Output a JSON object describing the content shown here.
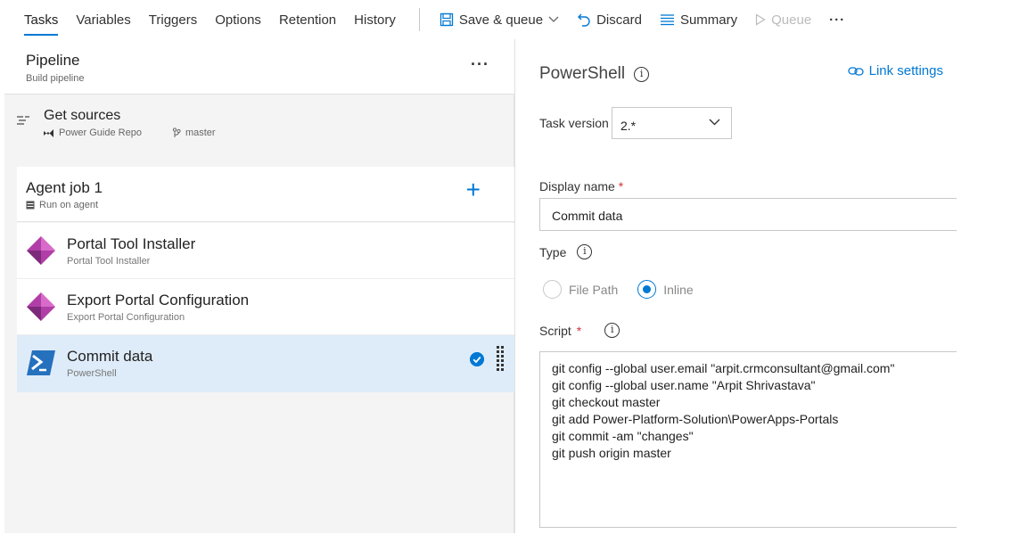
{
  "toolbar": {
    "tabs": [
      "Tasks",
      "Variables",
      "Triggers",
      "Options",
      "Retention",
      "History"
    ],
    "active_tab": "Tasks",
    "save_queue": "Save & queue",
    "discard": "Discard",
    "summary": "Summary",
    "queue": "Queue",
    "more": "···"
  },
  "pipeline": {
    "title": "Pipeline",
    "subtitle": "Build pipeline",
    "more": "···"
  },
  "get_sources": {
    "title": "Get sources",
    "repo": "Power Guide Repo",
    "branch": "master"
  },
  "agent_job": {
    "title": "Agent job 1",
    "subtitle": "Run on agent",
    "add": "+"
  },
  "tasks": [
    {
      "title": "Portal Tool Installer",
      "subtitle": "Portal Tool Installer",
      "icon": "power-apps-icon"
    },
    {
      "title": "Export Portal Configuration",
      "subtitle": "Export Portal Configuration",
      "icon": "power-apps-icon"
    },
    {
      "title": "Commit data",
      "subtitle": "PowerShell",
      "icon": "powershell-icon",
      "selected": true
    }
  ],
  "detail": {
    "title": "PowerShell",
    "link_settings": "Link settings",
    "task_version_label": "Task version",
    "task_version_value": "2.*",
    "display_name_label": "Display name",
    "required_mark": "*",
    "display_name_value": "Commit data",
    "type_label": "Type",
    "type_options": [
      "File Path",
      "Inline"
    ],
    "type_selected": "Inline",
    "script_label": "Script",
    "script_lines": [
      "git config --global user.email \"arpit.crmconsultant@gmail.com\"",
      "git config --global user.name \"Arpit Shrivastava\"",
      "git checkout master",
      "git add Power-Platform-Solution\\PowerApps-Portals",
      "git commit -am \"changes\"",
      "git push origin master"
    ]
  },
  "colors": {
    "accent": "#0078d4",
    "selected_row": "#deecf9",
    "required": "#d13438",
    "power_apps": "#b13ea8",
    "powershell": "#2671be"
  }
}
